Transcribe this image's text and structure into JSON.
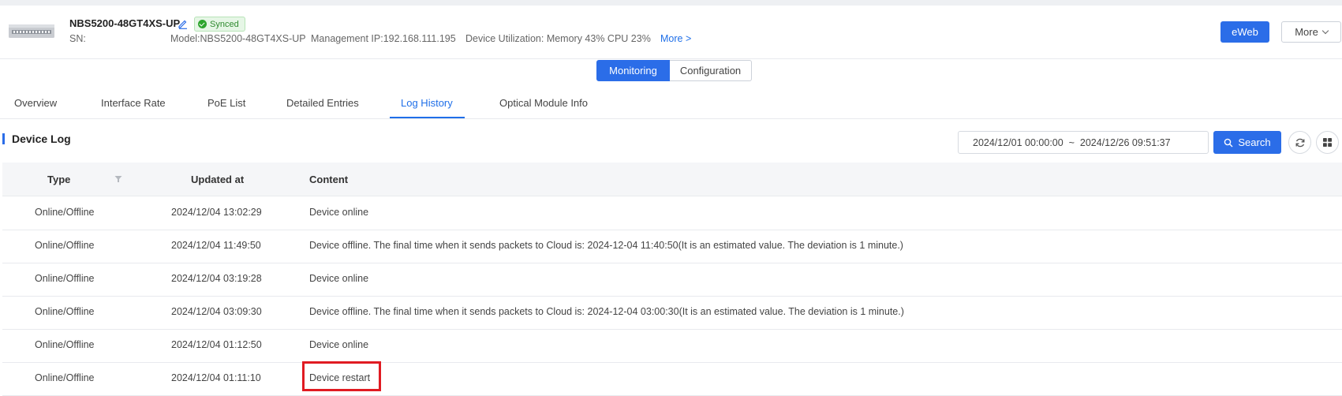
{
  "device": {
    "name": "NBS5200-48GT4XS-UP",
    "status": "Synced",
    "sn": "SN:",
    "model": "Model:NBS5200-48GT4XS-UP",
    "management_ip": "Management IP:192.168.111.195",
    "utilization": "Device Utilization: Memory 43% CPU 23%",
    "more_link": "More >"
  },
  "header_buttons": {
    "eweb": "eWeb",
    "more": "More"
  },
  "mode_toggle": {
    "monitoring": "Monitoring",
    "configuration": "Configuration",
    "selected": "Monitoring"
  },
  "tabs": [
    {
      "label": "Overview"
    },
    {
      "label": "Interface Rate"
    },
    {
      "label": "PoE List"
    },
    {
      "label": "Detailed Entries"
    },
    {
      "label": "Log History"
    },
    {
      "label": "Optical Module Info"
    }
  ],
  "active_tab": "Log History",
  "section": {
    "title": "Device Log"
  },
  "search": {
    "date_range": "2024/12/01 00:00:00  ~  2024/12/26 09:51:37",
    "button": "Search"
  },
  "table": {
    "columns": [
      "Type",
      "Updated at",
      "Content"
    ],
    "rows": [
      {
        "type": "Online/Offline",
        "updated": "2024/12/04 13:02:29",
        "content": "Device online"
      },
      {
        "type": "Online/Offline",
        "updated": "2024/12/04 11:49:50",
        "content": "Device offline. The final time when it sends packets to Cloud is: 2024-12-04 11:40:50(It is an estimated value. The deviation is 1 minute.)"
      },
      {
        "type": "Online/Offline",
        "updated": "2024/12/04 03:19:28",
        "content": "Device online"
      },
      {
        "type": "Online/Offline",
        "updated": "2024/12/04 03:09:30",
        "content": "Device offline. The final time when it sends packets to Cloud is: 2024-12-04 03:00:30(It is an estimated value. The deviation is 1 minute.)"
      },
      {
        "type": "Online/Offline",
        "updated": "2024/12/04 01:12:50",
        "content": "Device online"
      },
      {
        "type": "Online/Offline",
        "updated": "2024/12/04 01:11:10",
        "content": "Device restart"
      }
    ]
  },
  "colors": {
    "accent": "#2b6de8",
    "synced": "#2ea52e",
    "highlight": "#e01b22"
  },
  "icons": [
    "switch-device-icon",
    "edit-icon",
    "check-circle-icon",
    "chevron-down-icon",
    "search-icon",
    "refresh-icon",
    "grid-icon",
    "filter-icon"
  ]
}
